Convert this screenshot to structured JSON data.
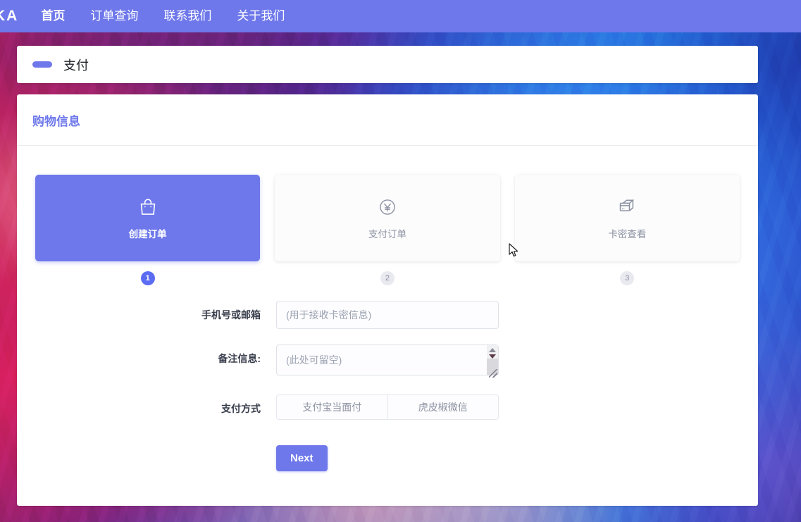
{
  "navbar": {
    "brand": "KA",
    "links": [
      {
        "label": "首页",
        "active": true
      },
      {
        "label": "订单查询",
        "active": false
      },
      {
        "label": "联系我们",
        "active": false
      },
      {
        "label": "关于我们",
        "active": false
      }
    ],
    "background_color": "#6e78ea"
  },
  "page_title": {
    "text": "支付",
    "accent_color": "#6e78ea"
  },
  "main": {
    "section_title": "购物信息",
    "section_title_color": "#6e78ea",
    "steps": [
      {
        "label": "创建订单",
        "icon": "shopping-bag-icon",
        "number": "1",
        "state": "active"
      },
      {
        "label": "支付订单",
        "icon": "yen-circle-icon",
        "number": "2",
        "state": "idle"
      },
      {
        "label": "卡密查看",
        "icon": "card-stack-icon",
        "number": "3",
        "state": "idle"
      }
    ],
    "form": {
      "contact": {
        "label": "手机号或邮箱",
        "placeholder": "(用于接收卡密信息)",
        "value": ""
      },
      "remark": {
        "label": "备注信息:",
        "placeholder": "(此处可留空)",
        "value": ""
      },
      "payment": {
        "label": "支付方式",
        "options": [
          {
            "label": "支付宝当面付",
            "selected": false
          },
          {
            "label": "虎皮椒微信",
            "selected": false
          }
        ]
      },
      "submit_label": "Next"
    }
  }
}
